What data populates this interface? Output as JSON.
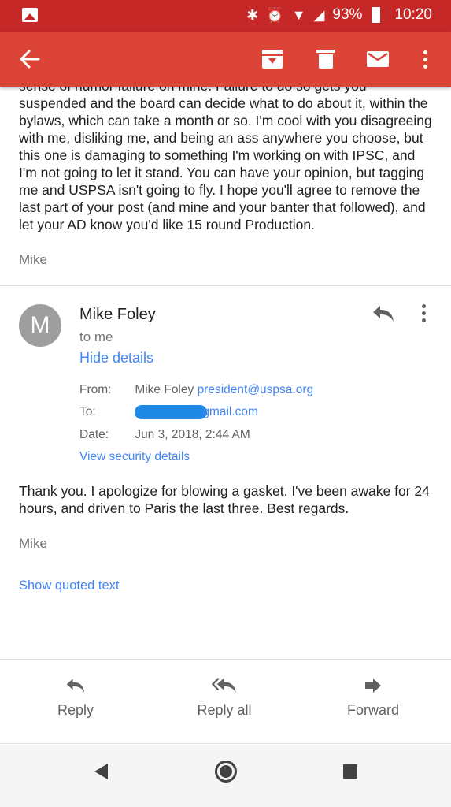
{
  "status_bar": {
    "battery": "93%",
    "time": "10:20",
    "icons": [
      "gallery-icon",
      "bluetooth-icon",
      "alarm-icon",
      "wifi-icon",
      "signal-icon",
      "battery-icon"
    ]
  },
  "toolbar": {
    "icons": [
      "back-arrow-icon",
      "archive-icon",
      "delete-icon",
      "mark-unread-icon",
      "more-vert-icon"
    ],
    "color": "#db4437"
  },
  "previous_message": {
    "body": "sense of humor failure on mine. Failure to do so gets you suspended and the board can decide what to do about it, within the bylaws, which can take a month or so.  I'm cool with you disagreeing with me, disliking me, and being an ass anywhere you choose, but this one is damaging to something I'm working on with IPSC, and I'm not going to let it stand.  You can have your opinion, but tagging me and USPSA isn't going to fly.  I hope you'll agree to remove the last part of your post (and mine and your banter that followed), and let your AD know you'd like 15 round Production.",
    "signature": "Mike"
  },
  "message": {
    "avatar_letter": "M",
    "sender": "Mike Foley",
    "to": "to me",
    "hide_details": "Hide details",
    "details": {
      "from_label": "From:",
      "from_name": "Mike Foley",
      "from_email": "president@uspsa.org",
      "to_label": "To:",
      "to_email": "gmail.com",
      "date_label": "Date:",
      "date_value": "Jun 3, 2018, 2:44 AM",
      "security_link": "View security details"
    },
    "body": "Thank you.  I apologize for blowing a gasket.  I've been awake for 24 hours, and driven to Paris the last three.  Best regards.",
    "signature": "Mike",
    "quoted_link": "Show quoted text"
  },
  "actions": {
    "reply": "Reply",
    "reply_all": "Reply all",
    "forward": "Forward"
  },
  "colors": {
    "link": "#4285f4",
    "status_bar": "#c62828"
  }
}
